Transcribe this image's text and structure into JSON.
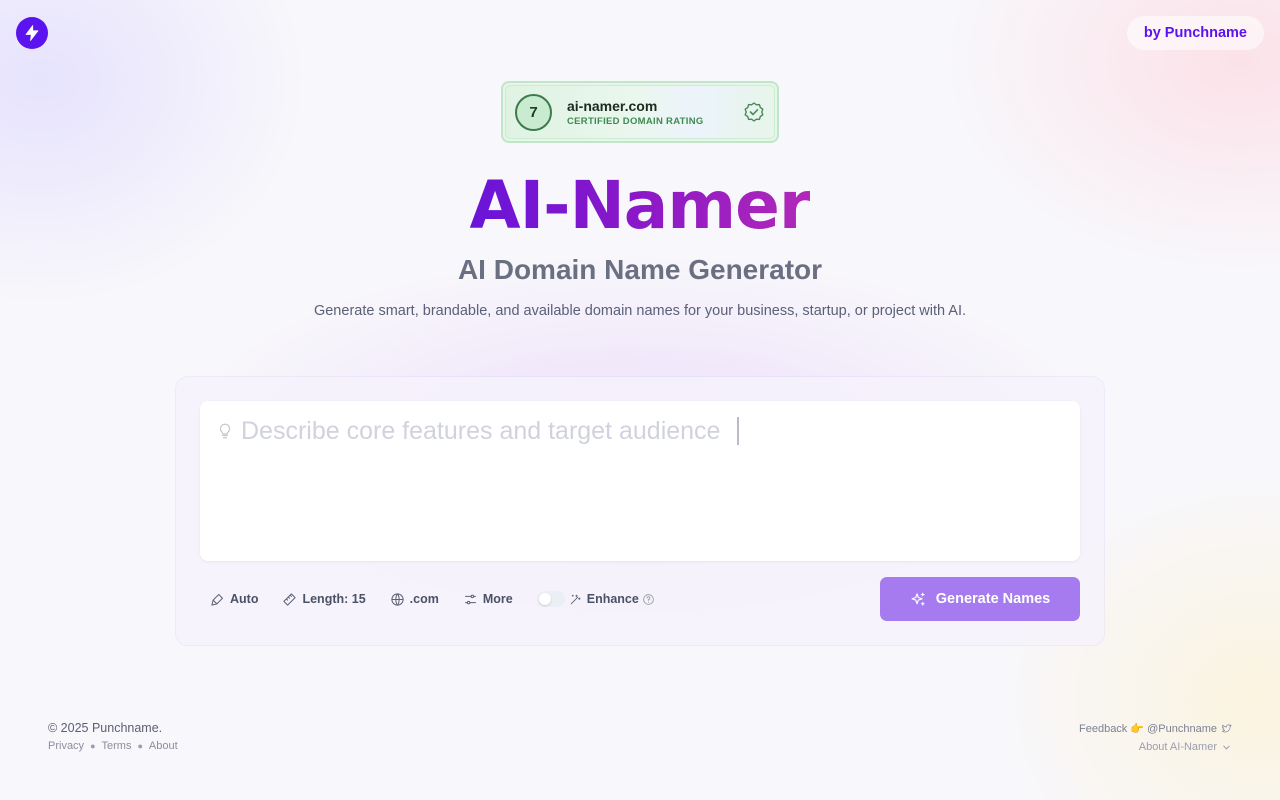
{
  "header": {
    "logo_icon": "lightning-icon",
    "brand_color": "#5b14f0",
    "by_link": "by Punchname"
  },
  "badge": {
    "score": "7",
    "domain": "ai-namer.com",
    "caption": "CERTIFIED DOMAIN RATING",
    "icon": "verified-check-icon"
  },
  "hero": {
    "title": "AI-Namer",
    "subtitle": "AI Domain Name Generator",
    "description": "Generate smart, brandable, and available domain names for your business, startup, or project with AI."
  },
  "form": {
    "input_icon": "lightbulb-icon",
    "placeholder": "Describe core features and target audience",
    "value": "",
    "options": {
      "style": "Auto",
      "length": "Length: 15",
      "tld": ".com",
      "more": "More",
      "enhance": "Enhance",
      "enhance_enabled": false
    },
    "generate_button": "Generate Names",
    "accent_color": "#a67bef"
  },
  "footer": {
    "copyright": "© 2025 Punchname.",
    "links": [
      "Privacy",
      "Terms",
      "About"
    ],
    "feedback": "Feedback 👉 @Punchname",
    "about_menu": "About AI-Namer"
  }
}
